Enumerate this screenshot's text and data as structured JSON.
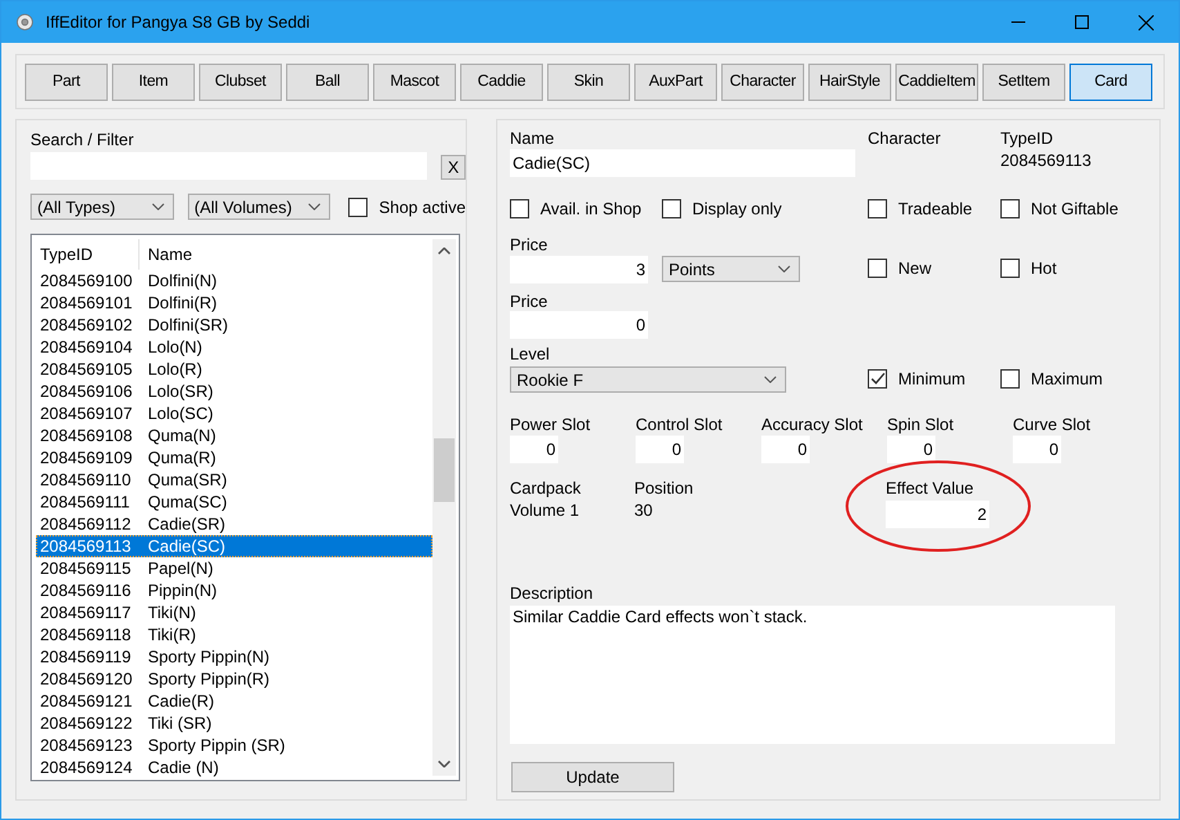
{
  "window": {
    "title": "IffEditor for Pangya S8 GB by Seddi"
  },
  "tabs": [
    {
      "label": "Part",
      "selected": false
    },
    {
      "label": "Item",
      "selected": false
    },
    {
      "label": "Clubset",
      "selected": false
    },
    {
      "label": "Ball",
      "selected": false
    },
    {
      "label": "Mascot",
      "selected": false
    },
    {
      "label": "Caddie",
      "selected": false
    },
    {
      "label": "Skin",
      "selected": false
    },
    {
      "label": "AuxPart",
      "selected": false
    },
    {
      "label": "Character",
      "selected": false
    },
    {
      "label": "HairStyle",
      "selected": false
    },
    {
      "label": "CaddieItem",
      "selected": false
    },
    {
      "label": "SetItem",
      "selected": false
    },
    {
      "label": "Card",
      "selected": true
    }
  ],
  "filter": {
    "label": "Search / Filter",
    "clear_button": "X",
    "type_select": "(All Types)",
    "volume_select": "(All Volumes)",
    "shop_active": {
      "label": "Shop active",
      "checked": false
    }
  },
  "list": {
    "columns": [
      "TypeID",
      "Name"
    ],
    "rows": [
      {
        "type_id": "2084569100",
        "name": "Dolfini(N)",
        "selected": false
      },
      {
        "type_id": "2084569101",
        "name": "Dolfini(R)",
        "selected": false
      },
      {
        "type_id": "2084569102",
        "name": "Dolfini(SR)",
        "selected": false
      },
      {
        "type_id": "2084569104",
        "name": "Lolo(N)",
        "selected": false
      },
      {
        "type_id": "2084569105",
        "name": "Lolo(R)",
        "selected": false
      },
      {
        "type_id": "2084569106",
        "name": "Lolo(SR)",
        "selected": false
      },
      {
        "type_id": "2084569107",
        "name": "Lolo(SC)",
        "selected": false
      },
      {
        "type_id": "2084569108",
        "name": "Quma(N)",
        "selected": false
      },
      {
        "type_id": "2084569109",
        "name": "Quma(R)",
        "selected": false
      },
      {
        "type_id": "2084569110",
        "name": "Quma(SR)",
        "selected": false
      },
      {
        "type_id": "2084569111",
        "name": "Quma(SC)",
        "selected": false
      },
      {
        "type_id": "2084569112",
        "name": "Cadie(SR)",
        "selected": false
      },
      {
        "type_id": "2084569113",
        "name": "Cadie(SC)",
        "selected": true
      },
      {
        "type_id": "2084569115",
        "name": "Papel(N)",
        "selected": false
      },
      {
        "type_id": "2084569116",
        "name": "Pippin(N)",
        "selected": false
      },
      {
        "type_id": "2084569117",
        "name": "Tiki(N)",
        "selected": false
      },
      {
        "type_id": "2084569118",
        "name": "Tiki(R)",
        "selected": false
      },
      {
        "type_id": "2084569119",
        "name": "Sporty Pippin(N)",
        "selected": false
      },
      {
        "type_id": "2084569120",
        "name": "Sporty Pippin(R)",
        "selected": false
      },
      {
        "type_id": "2084569121",
        "name": "Cadie(R)",
        "selected": false
      },
      {
        "type_id": "2084569122",
        "name": "Tiki (SR)",
        "selected": false
      },
      {
        "type_id": "2084569123",
        "name": "Sporty Pippin (SR)",
        "selected": false
      },
      {
        "type_id": "2084569124",
        "name": "Cadie (N)",
        "selected": false
      }
    ]
  },
  "detail": {
    "name": {
      "label": "Name",
      "value": "Cadie(SC)"
    },
    "character": {
      "label": "Character"
    },
    "type_id": {
      "label": "TypeID",
      "value": "2084569113"
    },
    "flags_top": [
      {
        "label": "Avail. in Shop",
        "checked": false
      },
      {
        "label": "Display only",
        "checked": false
      },
      {
        "label": "Tradeable",
        "checked": false
      },
      {
        "label": "Not Giftable",
        "checked": false
      }
    ],
    "price": {
      "label": "Price",
      "value": "3",
      "currency": "Points"
    },
    "flags_mid": [
      {
        "label": "New",
        "checked": false
      },
      {
        "label": "Hot",
        "checked": false
      }
    ],
    "price_discount": {
      "label": "Price",
      "value": "0"
    },
    "level": {
      "label": "Level",
      "value": "Rookie F"
    },
    "flags_level": [
      {
        "label": "Minimum",
        "checked": true
      },
      {
        "label": "Maximum",
        "checked": false
      }
    ],
    "slots": [
      {
        "label": "Power Slot",
        "value": "0"
      },
      {
        "label": "Control Slot",
        "value": "0"
      },
      {
        "label": "Accuracy Slot",
        "value": "0"
      },
      {
        "label": "Spin Slot",
        "value": "0"
      },
      {
        "label": "Curve Slot",
        "value": "0"
      }
    ],
    "cardpack": {
      "label": "Cardpack",
      "value": "Volume 1"
    },
    "position": {
      "label": "Position",
      "value": "30"
    },
    "effect": {
      "label": "Effect Value",
      "value": "2",
      "highlighted": true
    },
    "description": {
      "label": "Description",
      "value": "Similar Caddie Card effects won`t stack."
    },
    "update_button": "Update"
  }
}
